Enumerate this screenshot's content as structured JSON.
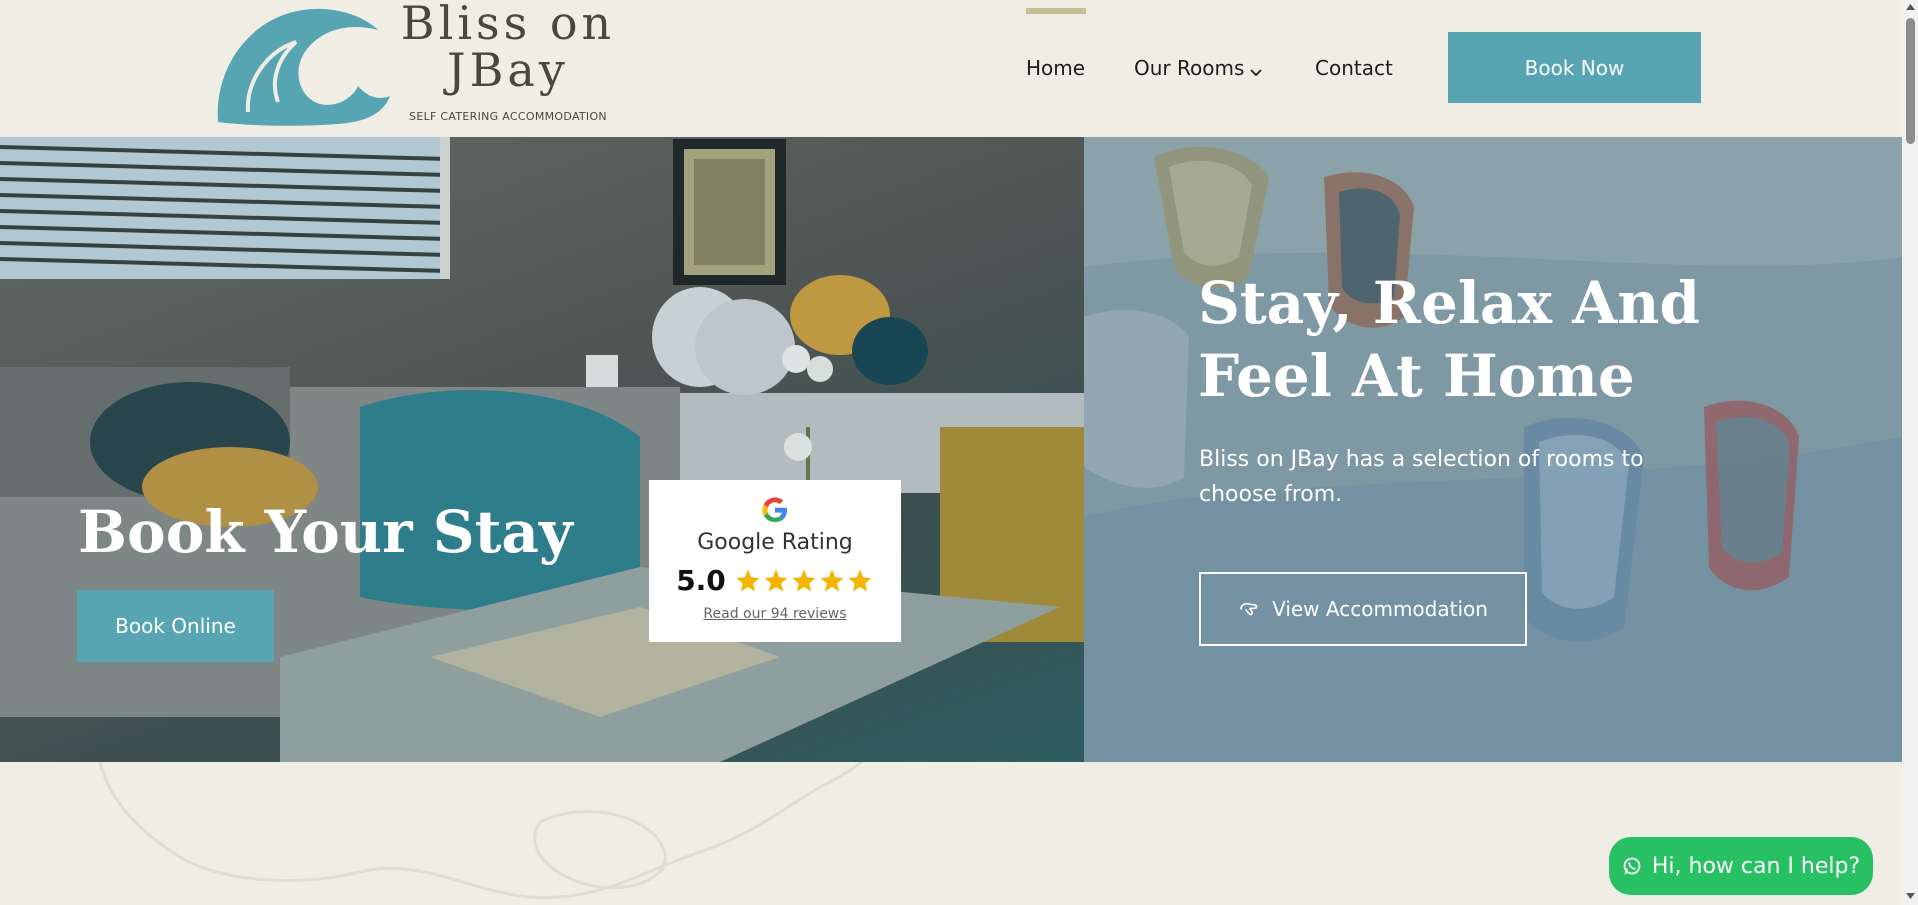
{
  "header": {
    "logo": {
      "title": "Bliss on JBay",
      "tagline": "SELF CATERING ACCOMMODATION"
    },
    "nav": [
      {
        "label": "Home",
        "active": true
      },
      {
        "label": "Our Rooms",
        "has_dropdown": true
      },
      {
        "label": "Contact"
      }
    ],
    "book_now_label": "Book Now"
  },
  "hero": {
    "left": {
      "title": "Book Your Stay",
      "button_label": "Book Online",
      "rating_card": {
        "title": "Google Rating",
        "score": "5.0",
        "stars": 5,
        "link_text": "Read our 94 reviews"
      }
    },
    "right": {
      "title": "Stay, Relax And Feel At Home",
      "description": "Bliss on JBay has a selection of rooms to choose from.",
      "button_label": "View Accommodation"
    }
  },
  "chat": {
    "label": "Hi, how can I help?"
  },
  "colors": {
    "background": "#f0ede5",
    "brand_teal": "#57a5b2",
    "nav_active_bar": "#c6bf96",
    "star_gold": "#f4b400",
    "whatsapp_green": "#27c164"
  },
  "icons": {
    "logo": "wave-icon",
    "dropdown": "chevron-down-icon",
    "google": "google-g-icon",
    "star": "star-icon",
    "view_button": "hand-pointer-icon",
    "chat": "whatsapp-icon"
  }
}
